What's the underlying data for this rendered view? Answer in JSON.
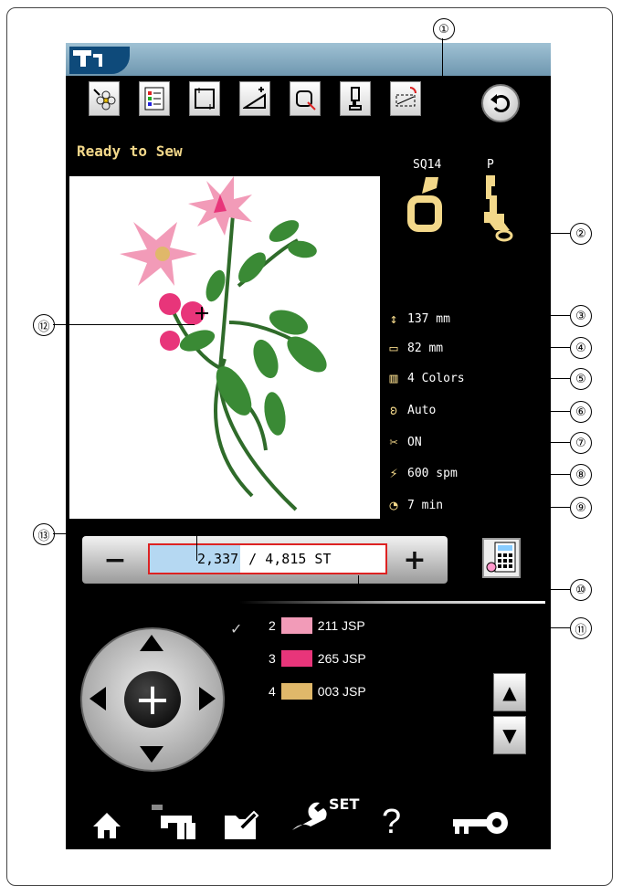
{
  "status": "Ready to Sew",
  "hoop": {
    "name": "SQ14"
  },
  "foot": {
    "name": "P"
  },
  "info": {
    "height": "137 mm",
    "width": "82 mm",
    "colors": "4 Colors",
    "tension": "Auto",
    "trim": "ON",
    "speed": "600 spm",
    "time": "7 min"
  },
  "stitch_counter": {
    "current": "2,337",
    "rest": " / 4,815 ST"
  },
  "stepper": {
    "minus": "−",
    "plus": "+"
  },
  "threads": [
    {
      "index": "2",
      "code": "211 JSP",
      "color": "#f29bb8"
    },
    {
      "index": "3",
      "code": "265 JSP",
      "color": "#e8357a"
    },
    {
      "index": "4",
      "code": "003 JSP",
      "color": "#e0b86a"
    }
  ],
  "bottom_bar": {
    "set_label": "SET",
    "help_label": "?"
  },
  "callouts": [
    "①",
    "②",
    "③",
    "④",
    "⑤",
    "⑥",
    "⑦",
    "⑧",
    "⑨",
    "⑩",
    "⑪",
    "⑫",
    "⑬"
  ],
  "colors": {
    "accent_text": "#f3d88a",
    "topbar": "#8fb3c8"
  }
}
